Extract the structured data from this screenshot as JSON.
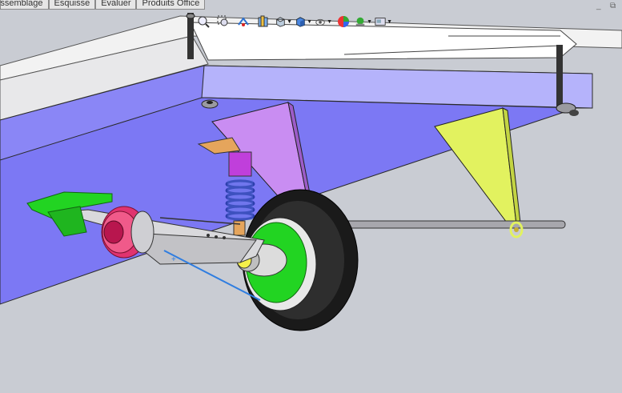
{
  "tabs": [
    {
      "label": "Assemblage"
    },
    {
      "label": "Esquisse"
    },
    {
      "label": "Évaluer"
    },
    {
      "label": "Produits Office"
    }
  ],
  "window": {
    "minimize_glyph": "_",
    "restore_glyph": "⧉"
  },
  "toolbar": {
    "items": [
      {
        "name": "zoom-to-fit-icon"
      },
      {
        "name": "zoom-to-area-icon"
      },
      {
        "name": "previous-view-icon"
      },
      {
        "name": "section-view-icon"
      },
      {
        "name": "view-orientation-icon"
      },
      {
        "name": "display-style-icon"
      },
      {
        "name": "hide-show-items-icon"
      },
      {
        "name": "edit-appearance-icon"
      },
      {
        "name": "apply-scene-icon"
      },
      {
        "name": "view-settings-icon"
      }
    ]
  },
  "colors": {
    "background": "#c9ccd3",
    "chassis_blue": "#8a86f6",
    "chassis_light": "#b5b3fb",
    "bracket_violet": "#c98df2",
    "bracket_yellow": "#e2f25f",
    "hub_green": "#22d422",
    "brake_magenta": "#e0336f",
    "coil_blue": "#5c73e0",
    "damper_purple": "#c03fdb",
    "mount_orange": "#e5a55c"
  }
}
